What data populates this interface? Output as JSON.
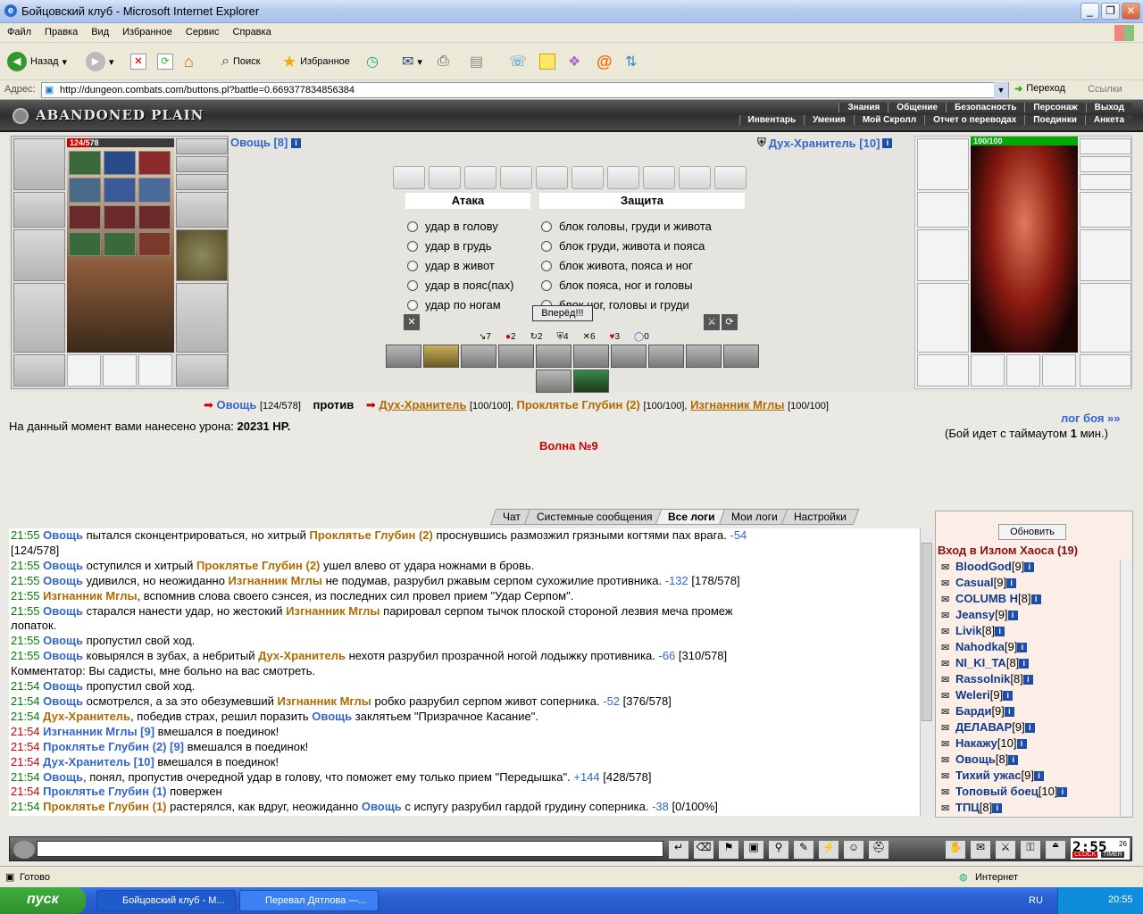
{
  "window": {
    "title": "Бойцовский клуб - Microsoft Internet Explorer"
  },
  "menu": [
    "Файл",
    "Правка",
    "Вид",
    "Избранное",
    "Сервис",
    "Справка"
  ],
  "toolbar": {
    "back": "Назад",
    "search": "Поиск",
    "favorites": "Избранное"
  },
  "address": {
    "label": "Адрес:",
    "url": "http://dungeon.combats.com/buttons.pl?battle=0.669377834856384",
    "go": "Переход",
    "links": "Ссылки"
  },
  "game": {
    "location": "ABANDONED PLAIN",
    "nav_top": [
      "Знания",
      "Общение",
      "Безопасность",
      "Персонаж",
      "Выход"
    ],
    "nav_bottom": [
      "Инвентарь",
      "Умения",
      "Мой Скролл",
      "Отчет о переводах",
      "Поединки",
      "Анкета"
    ]
  },
  "player": {
    "name": "Овощь [8]",
    "hp": "124/578",
    "hp_fraction": 0.215
  },
  "enemy": {
    "name": "Дух-Хранитель [10]",
    "hp": "100/100",
    "hp_fraction": 1.0
  },
  "attack": {
    "header": "Атака",
    "options": [
      "удар в голову",
      "удар в грудь",
      "удар в живот",
      "удар в пояс(пах)",
      "удар по ногам"
    ]
  },
  "defense": {
    "header": "Защита",
    "options": [
      "блок головы, груди и живота",
      "блок груди, живота и пояса",
      "блок живота, пояса и ног",
      "блок пояса, ног и головы",
      "блок ног, головы и груди"
    ]
  },
  "forward_button": "Вперёд!!!",
  "stats": [
    "7",
    "2",
    "2",
    "4",
    "6",
    "3",
    "0"
  ],
  "battle": {
    "me": "Овощь",
    "me_hp": "[124/578]",
    "versus": "против",
    "enemies": [
      {
        "name": "Дух-Хранитель",
        "hp": "[100/100],"
      },
      {
        "name": "Проклятье Глубин (2)",
        "hp": "[100/100],"
      },
      {
        "name": "Изгнанник Мглы",
        "hp": "[100/100]"
      }
    ],
    "damage_label": "На данный момент вами нанесено урона:",
    "damage_value": "20231 HP.",
    "log_link": "лог боя »»",
    "timeout_prefix": "(Бой идет с таймаутом",
    "timeout_value": "1",
    "timeout_suffix": "мин.)",
    "wave": "Волна №9"
  },
  "tabs": [
    "Чат",
    "Системные сообщения",
    "Все логи",
    "Мои логи",
    "Настройки"
  ],
  "log": [
    {
      "t": "21:55",
      "parts": [
        [
          "n",
          "Овощь"
        ],
        [
          "x",
          " пытался сконцентрироваться, но хитрый "
        ],
        [
          "e",
          "Проклятье Глубин (2)"
        ],
        [
          "x",
          " проснувшись размозжил грязными когтями пах врага. "
        ],
        [
          "d",
          "-54"
        ]
      ]
    },
    {
      "t": "",
      "parts": [
        [
          "x",
          "[124/578]"
        ]
      ]
    },
    {
      "t": "21:55",
      "parts": [
        [
          "n",
          "Овощь"
        ],
        [
          "x",
          " оступился и хитрый "
        ],
        [
          "e",
          "Проклятье Глубин (2)"
        ],
        [
          "x",
          " ушел влево от удара ножнами в бровь."
        ]
      ]
    },
    {
      "t": "21:55",
      "parts": [
        [
          "n",
          "Овощь"
        ],
        [
          "x",
          " удивился, но неожиданно "
        ],
        [
          "e",
          "Изгнанник Мглы"
        ],
        [
          "x",
          " не подумав, разрубил ржавым серпом сухожилие противника. "
        ],
        [
          "d",
          "-132"
        ],
        [
          "x",
          " [178/578]"
        ]
      ]
    },
    {
      "t": "21:55",
      "parts": [
        [
          "e",
          "Изгнанник Мглы"
        ],
        [
          "x",
          ", вспомнив слова своего сэнсея, из последних сил провел прием \"Удар Серпом\"."
        ]
      ]
    },
    {
      "t": "21:55",
      "parts": [
        [
          "n",
          "Овощь"
        ],
        [
          "x",
          " старался нанести удар, но жестокий "
        ],
        [
          "e",
          "Изгнанник Мглы"
        ],
        [
          "x",
          " парировал серпом тычок плоской стороной лезвия меча промеж"
        ]
      ]
    },
    {
      "t": "",
      "parts": [
        [
          "x",
          "лопаток."
        ]
      ]
    },
    {
      "t": "21:55",
      "parts": [
        [
          "n",
          "Овощь"
        ],
        [
          "x",
          " пропустил свой ход."
        ]
      ]
    },
    {
      "t": "21:55",
      "parts": [
        [
          "n",
          "Овощь"
        ],
        [
          "x",
          " ковырялся в зубах, а небритый "
        ],
        [
          "e",
          "Дух-Хранитель"
        ],
        [
          "x",
          " нехотя разрубил прозрачной ногой лодыжку противника. "
        ],
        [
          "d",
          "-66"
        ],
        [
          "x",
          " [310/578]"
        ]
      ]
    },
    {
      "t": "",
      "parts": [
        [
          "x",
          "Комментатор: Вы садисты, мне больно на вас смотреть."
        ]
      ]
    },
    {
      "t": "21:54",
      "parts": [
        [
          "n",
          "Овощь"
        ],
        [
          "x",
          " пропустил свой ход."
        ]
      ]
    },
    {
      "t": "21:54",
      "parts": [
        [
          "n",
          "Овощь"
        ],
        [
          "x",
          " осмотрелся, а за это обезумевший "
        ],
        [
          "e",
          "Изгнанник Мглы"
        ],
        [
          "x",
          " робко разрубил серпом живот соперника. "
        ],
        [
          "d",
          "-52"
        ],
        [
          "x",
          " [376/578]"
        ]
      ]
    },
    {
      "t": "21:54",
      "parts": [
        [
          "e",
          "Дух-Хранитель"
        ],
        [
          "x",
          ", победив страх, решил поразить "
        ],
        [
          "n",
          "Овощь"
        ],
        [
          "x",
          " заклятьем \"Призрачное Касание\"."
        ]
      ]
    },
    {
      "t": "21:54",
      "r": true,
      "parts": [
        [
          "n",
          "Изгнанник Мглы [9]"
        ],
        [
          "x",
          " вмешался в поединок!"
        ]
      ]
    },
    {
      "t": "21:54",
      "r": true,
      "parts": [
        [
          "n",
          "Проклятье Глубин (2) [9]"
        ],
        [
          "x",
          " вмешался в поединок!"
        ]
      ]
    },
    {
      "t": "21:54",
      "r": true,
      "parts": [
        [
          "n",
          "Дух-Хранитель [10]"
        ],
        [
          "x",
          " вмешался в поединок!"
        ]
      ]
    },
    {
      "t": "21:54",
      "parts": [
        [
          "n",
          "Овощь"
        ],
        [
          "x",
          ", понял, пропустив очередной удар в голову, что поможет ему только прием \"Передышка\". "
        ],
        [
          "d",
          "+144"
        ],
        [
          "x",
          " [428/578]"
        ]
      ]
    },
    {
      "t": "21:54",
      "r": true,
      "parts": [
        [
          "n",
          "Проклятье Глубин (1)"
        ],
        [
          "x",
          " повержен"
        ]
      ]
    },
    {
      "t": "21:54",
      "parts": [
        [
          "e",
          "Проклятье Глубин (1)"
        ],
        [
          "x",
          " растерялся, как вдруг, неожиданно "
        ],
        [
          "n",
          "Овощь"
        ],
        [
          "x",
          " с испугу разрубил гардой грудину соперника. "
        ],
        [
          "d",
          "-38"
        ],
        [
          "x",
          " [0/100%]"
        ]
      ]
    }
  ],
  "room": {
    "refresh": "Обновить",
    "title": "Вход в Излом Хаоса (19)",
    "users": [
      {
        "name": "BloodGod",
        "lvl": "[9]"
      },
      {
        "name": "Casual",
        "lvl": "[9]"
      },
      {
        "name": "COLUMB H",
        "lvl": "[8]"
      },
      {
        "name": "Jeansy",
        "lvl": "[9]"
      },
      {
        "name": "Livik",
        "lvl": "[8]"
      },
      {
        "name": "Nahodka",
        "lvl": "[9]"
      },
      {
        "name": "NI_KI_TA",
        "lvl": "[8]"
      },
      {
        "name": "Rassolnik",
        "lvl": "[8]"
      },
      {
        "name": "Weleri",
        "lvl": "[9]"
      },
      {
        "name": "Барди",
        "lvl": "[9]"
      },
      {
        "name": "ДЕЛАВАР",
        "lvl": "[9]"
      },
      {
        "name": "Накажу",
        "lvl": "[10]"
      },
      {
        "name": "Овощь",
        "lvl": "[8]"
      },
      {
        "name": "Тихий ужас",
        "lvl": "[9]"
      },
      {
        "name": "Топовый боец",
        "lvl": "[10]"
      },
      {
        "name": "ТПЦ",
        "lvl": "[8]"
      }
    ]
  },
  "clock": {
    "time": "2:55",
    "sec": "26",
    "label1": "CLOCK",
    "label2": "TIMER"
  },
  "statusbar": {
    "left": "Готово",
    "zone": "Интернет"
  },
  "taskbar": {
    "start": "пуск",
    "tasks": [
      "Бойцовский клуб - М...",
      "Перевал Дятлова —..."
    ],
    "lang": "RU",
    "time": "20:55"
  }
}
